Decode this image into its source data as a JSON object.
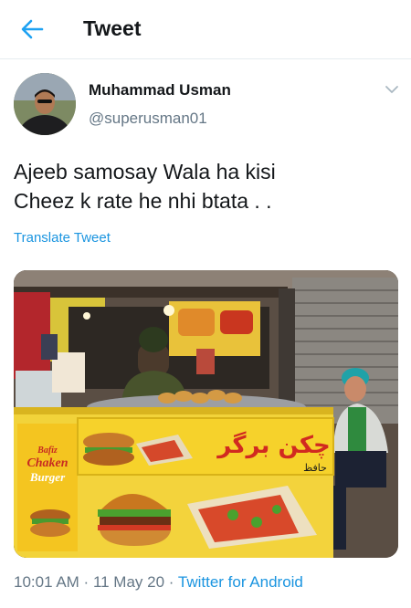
{
  "header": {
    "title": "Tweet",
    "back_icon": "back-arrow-icon"
  },
  "author": {
    "name": "Muhammad Usman",
    "handle": "@superusman01"
  },
  "tweet": {
    "lines": [
      "Ajeeb samosay Wala ha kisi",
      "Cheez k rate he nhi btata . ."
    ],
    "translate_label": "Translate Tweet"
  },
  "media": {
    "signs": {
      "urdu_main": "چکن برگر",
      "urdu_sub": "حافظ",
      "side_line1": "Bafiz",
      "side_line2": "Chaken",
      "side_line3": "Burger"
    }
  },
  "meta": {
    "time": "10:01 AM",
    "sep1": " · ",
    "date": "11 May 20",
    "sep2": " · ",
    "app": "Twitter for Android"
  },
  "colors": {
    "accent": "#1da1f2",
    "link": "#1b95e0",
    "muted": "#657786",
    "text": "#14171a"
  }
}
